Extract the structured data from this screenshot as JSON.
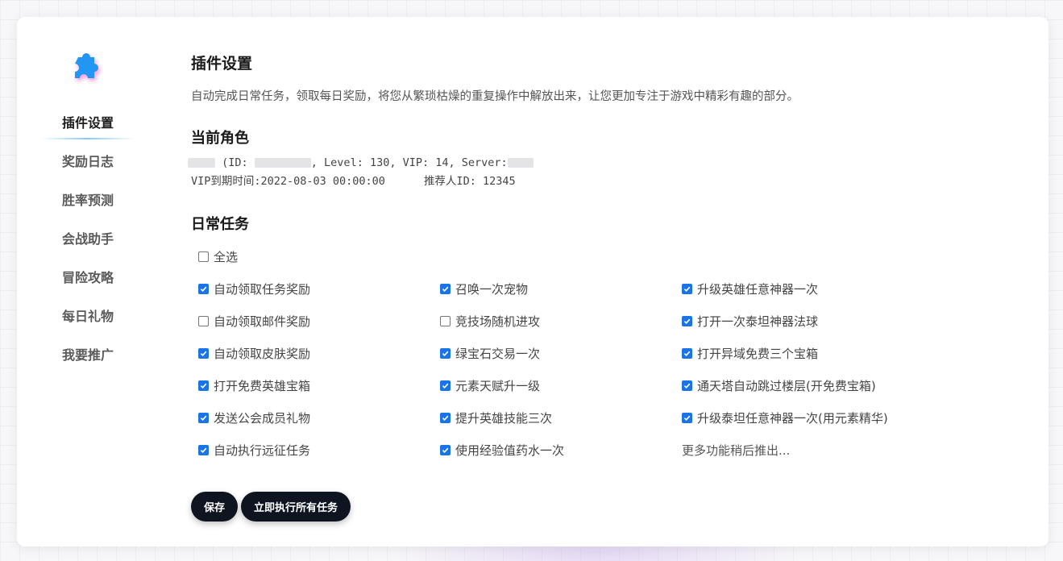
{
  "sidebar": {
    "items": [
      {
        "label": "插件设置",
        "active": true
      },
      {
        "label": "奖励日志",
        "active": false
      },
      {
        "label": "胜率预测",
        "active": false
      },
      {
        "label": "会战助手",
        "active": false
      },
      {
        "label": "冒险攻略",
        "active": false
      },
      {
        "label": "每日礼物",
        "active": false
      },
      {
        "label": "我要推广",
        "active": false
      }
    ]
  },
  "header": {
    "title": "插件设置",
    "description": "自动完成日常任务，领取每日奖励，将您从繁琐枯燥的重复操作中解放出来，让您更加专注于游戏中精彩有趣的部分。"
  },
  "role": {
    "section_title": "当前角色",
    "id_prefix": "(ID:",
    "level_text": ", Level: 130, VIP: 14, Server:",
    "vip_expire": "VIP到期时间:2022-08-03 00:00:00",
    "referrer": "推荐人ID: 12345"
  },
  "daily": {
    "section_title": "日常任务",
    "select_all_label": "全选",
    "select_all_checked": false,
    "tasks": [
      {
        "label": "自动领取任务奖励",
        "checked": true
      },
      {
        "label": "召唤一次宠物",
        "checked": true
      },
      {
        "label": "升级英雄任意神器一次",
        "checked": true
      },
      {
        "label": "自动领取邮件奖励",
        "checked": false
      },
      {
        "label": "竞技场随机进攻",
        "checked": false
      },
      {
        "label": "打开一次泰坦神器法球",
        "checked": true
      },
      {
        "label": "自动领取皮肤奖励",
        "checked": true
      },
      {
        "label": "绿宝石交易一次",
        "checked": true
      },
      {
        "label": "打开异域免费三个宝箱",
        "checked": true
      },
      {
        "label": "打开免费英雄宝箱",
        "checked": true
      },
      {
        "label": "元素天赋升一级",
        "checked": true
      },
      {
        "label": "通天塔自动跳过楼层(开免费宝箱)",
        "checked": true
      },
      {
        "label": "发送公会成员礼物",
        "checked": true
      },
      {
        "label": "提升英雄技能三次",
        "checked": true
      },
      {
        "label": "升级泰坦任意神器一次(用元素精华)",
        "checked": true
      },
      {
        "label": "自动执行远征任务",
        "checked": true
      },
      {
        "label": "使用经验值药水一次",
        "checked": true
      }
    ],
    "more_text": "更多功能稍后推出..."
  },
  "actions": {
    "save_label": "保存",
    "run_all_label": "立即执行所有任务"
  },
  "colors": {
    "checkbox_checked": "#1a73e8",
    "button_bg": "#0f1520",
    "logo_blue": "#2196f3",
    "logo_glow": "#ff6ec7",
    "active_underline": "#79c4f7"
  },
  "icons": {
    "logo": "puzzle-piece-icon",
    "check": "checkmark-icon"
  }
}
